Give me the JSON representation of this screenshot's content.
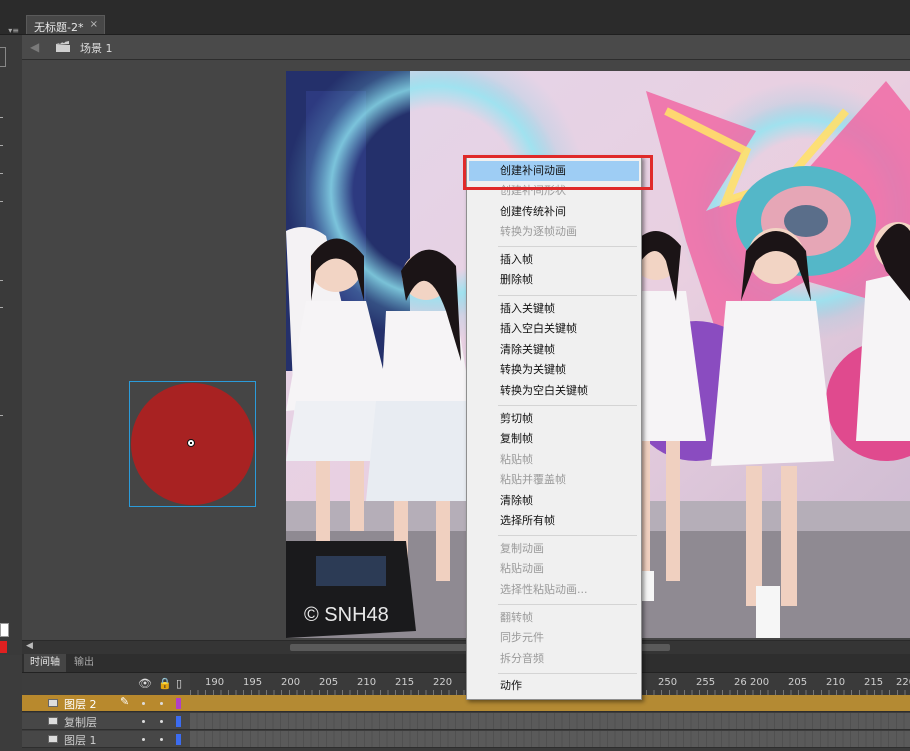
{
  "doc_tab": {
    "title": "无标题-2*",
    "close": "×"
  },
  "scene": {
    "label": "场景 1"
  },
  "stage": {
    "watermark": "© SNH48",
    "circle_color": "#a82222",
    "selection_color": "#2b9bd9"
  },
  "panel_tabs": [
    "时间轴",
    "输出"
  ],
  "timeline": {
    "ruler_labels": [
      "190",
      "195",
      "200",
      "205",
      "210",
      "215",
      "220",
      "250",
      "255",
      "26",
      "200",
      "205",
      "210",
      "215",
      "220"
    ],
    "header_icons": {
      "eye": "eye-icon",
      "lock": "lock-icon",
      "outline": "outline-icon"
    }
  },
  "layers": [
    {
      "name": "图层 2",
      "color": "#b040c8",
      "selected": true
    },
    {
      "name": "复制层",
      "color": "#3c6cf0",
      "selected": false
    },
    {
      "name": "图层 1",
      "color": "#3c6cf0",
      "selected": false
    }
  ],
  "context_menu": {
    "items": [
      {
        "label": "创建补间动画",
        "enabled": true,
        "highlighted": true
      },
      {
        "label": "创建补间形状",
        "enabled": false
      },
      {
        "label": "创建传统补间",
        "enabled": true
      },
      {
        "label": "转换为逐帧动画",
        "enabled": false
      },
      {
        "label": "插入帧",
        "enabled": true
      },
      {
        "label": "删除帧",
        "enabled": true
      },
      {
        "label": "插入关键帧",
        "enabled": true
      },
      {
        "label": "插入空白关键帧",
        "enabled": true
      },
      {
        "label": "清除关键帧",
        "enabled": true
      },
      {
        "label": "转换为关键帧",
        "enabled": true
      },
      {
        "label": "转换为空白关键帧",
        "enabled": true
      },
      {
        "label": "剪切帧",
        "enabled": true
      },
      {
        "label": "复制帧",
        "enabled": true
      },
      {
        "label": "粘贴帧",
        "enabled": false
      },
      {
        "label": "粘贴并覆盖帧",
        "enabled": false
      },
      {
        "label": "清除帧",
        "enabled": true
      },
      {
        "label": "选择所有帧",
        "enabled": true
      },
      {
        "label": "复制动画",
        "enabled": false
      },
      {
        "label": "粘贴动画",
        "enabled": false
      },
      {
        "label": "选择性粘贴动画...",
        "enabled": false
      },
      {
        "label": "翻转帧",
        "enabled": false
      },
      {
        "label": "同步元件",
        "enabled": false
      },
      {
        "label": "拆分音频",
        "enabled": false
      },
      {
        "label": "动作",
        "enabled": true
      }
    ],
    "highlight_color": "#9ecdf4",
    "annotation_color": "#e02a2a"
  }
}
